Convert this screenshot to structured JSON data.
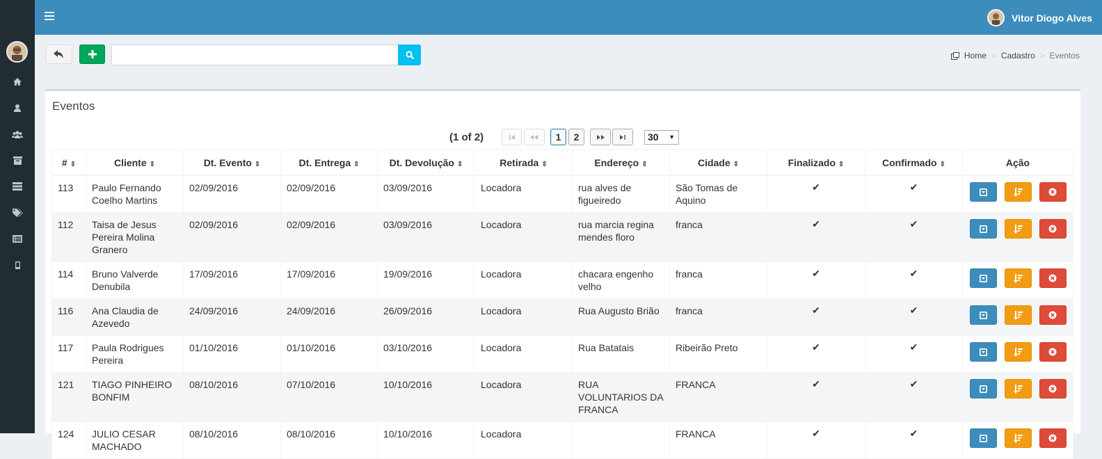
{
  "user": {
    "name": "Vitor Diogo Alves"
  },
  "sidebar": {
    "items": [
      {
        "icon": "home-icon"
      },
      {
        "icon": "user-icon"
      },
      {
        "icon": "users-icon"
      },
      {
        "icon": "archive-icon"
      },
      {
        "icon": "tasks-icon"
      },
      {
        "icon": "tags-icon"
      },
      {
        "icon": "list-icon"
      },
      {
        "icon": "mobile-icon"
      }
    ]
  },
  "breadcrumb": {
    "home": "Home",
    "cadastro": "Cadastro",
    "current": "Eventos"
  },
  "search": {
    "value": "",
    "placeholder": ""
  },
  "box": {
    "title": "Eventos"
  },
  "paginator": {
    "status": "(1 of 2)",
    "pages": [
      "1",
      "2"
    ],
    "current_page": "1",
    "rows_per_page": "30"
  },
  "table": {
    "headers": [
      "#",
      "Cliente",
      "Dt. Evento",
      "Dt. Entrega",
      "Dt. Devolução",
      "Retirada",
      "Endereço",
      "Cidade",
      "Finalizado",
      "Confirmado",
      "Ação"
    ],
    "check_glyph": "✔",
    "rows": [
      {
        "id": "113",
        "cliente": "Paulo Fernando Coelho Martins",
        "dt_evento": "02/09/2016",
        "dt_entrega": "02/09/2016",
        "dt_devolucao": "03/09/2016",
        "retirada": "Locadora",
        "endereco": "rua alves de figueiredo",
        "cidade": "São Tomas de Aquino",
        "finalizado": true,
        "confirmado": true
      },
      {
        "id": "112",
        "cliente": "Taisa de Jesus Pereira Molina Granero",
        "dt_evento": "02/09/2016",
        "dt_entrega": "02/09/2016",
        "dt_devolucao": "03/09/2016",
        "retirada": "Locadora",
        "endereco": "rua marcia regina mendes floro",
        "cidade": "franca",
        "finalizado": true,
        "confirmado": true
      },
      {
        "id": "114",
        "cliente": "Bruno Valverde Denubila",
        "dt_evento": "17/09/2016",
        "dt_entrega": "17/09/2016",
        "dt_devolucao": "19/09/2016",
        "retirada": "Locadora",
        "endereco": "chacara engenho velho",
        "cidade": "franca",
        "finalizado": true,
        "confirmado": true
      },
      {
        "id": "116",
        "cliente": "Ana Claudia de Azevedo",
        "dt_evento": "24/09/2016",
        "dt_entrega": "24/09/2016",
        "dt_devolucao": "26/09/2016",
        "retirada": "Locadora",
        "endereco": "Rua Augusto Brião",
        "cidade": "franca",
        "finalizado": true,
        "confirmado": true
      },
      {
        "id": "117",
        "cliente": "Paula Rodrigues Pereira",
        "dt_evento": "01/10/2016",
        "dt_entrega": "01/10/2016",
        "dt_devolucao": "03/10/2016",
        "retirada": "Locadora",
        "endereco": "Rua Batatais",
        "cidade": "Ribeirão Preto",
        "finalizado": true,
        "confirmado": true
      },
      {
        "id": "121",
        "cliente": "TIAGO PINHEIRO BONFIM",
        "dt_evento": "08/10/2016",
        "dt_entrega": "07/10/2016",
        "dt_devolucao": "10/10/2016",
        "retirada": "Locadora",
        "endereco": "RUA VOLUNTARIOS DA FRANCA",
        "cidade": "FRANCA",
        "finalizado": true,
        "confirmado": true
      },
      {
        "id": "124",
        "cliente": "JULIO CESAR MACHADO",
        "dt_evento": "08/10/2016",
        "dt_entrega": "08/10/2016",
        "dt_devolucao": "10/10/2016",
        "retirada": "Locadora",
        "endereco": "",
        "cidade": "FRANCA",
        "finalizado": true,
        "confirmado": true
      }
    ]
  },
  "colors": {
    "topbar": "#3c8dbc",
    "sidebar": "#222d32",
    "add": "#00a65a",
    "search": "#00c0ef",
    "edit": "#3c8dbc",
    "sort": "#f39c12",
    "delete": "#dd4b39"
  }
}
